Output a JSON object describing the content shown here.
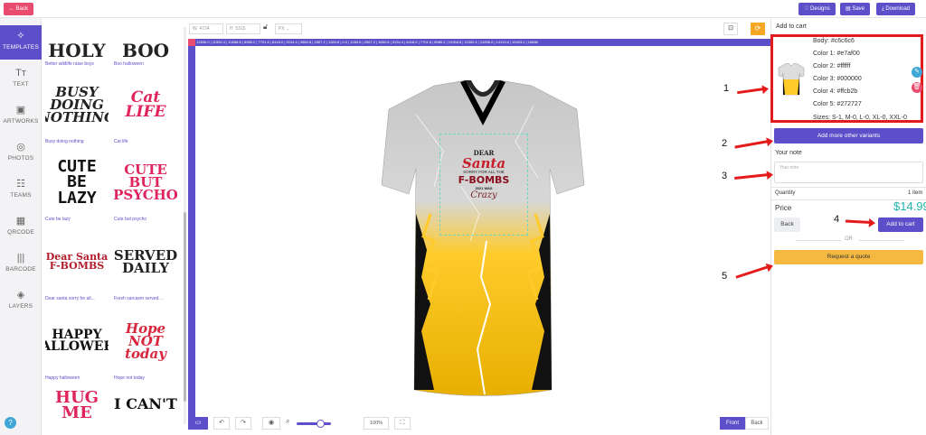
{
  "topbar": {
    "back": "Back",
    "designs": "♡ Designs",
    "save": "Save",
    "download": "Download"
  },
  "sidebar": [
    {
      "icon": "✧",
      "label": "TEMPLATES"
    },
    {
      "icon": "Tт",
      "label": "TEXT"
    },
    {
      "icon": "▣",
      "label": "ARTWORKS"
    },
    {
      "icon": "◎",
      "label": "PHOTOS"
    },
    {
      "icon": "☷",
      "label": "TEAMS"
    },
    {
      "icon": "▦",
      "label": "QRCODE"
    },
    {
      "icon": "|||",
      "label": "BARCODE"
    },
    {
      "icon": "◈",
      "label": "LAYERS"
    }
  ],
  "templates": [
    {
      "caption": "Better wildlife raise boys",
      "art": "HOLY"
    },
    {
      "caption": "Boo halloween",
      "art": "BOO"
    },
    {
      "caption": "Busy doing nothing",
      "art": "BUSY DOING NOTHING"
    },
    {
      "caption": "Cat life",
      "art": "Cat LIFE"
    },
    {
      "caption": "Cute be lazy",
      "art": "CUTE BE LAZY"
    },
    {
      "caption": "Cute but psycho",
      "art": "CUTE BUT PSYCHO"
    },
    {
      "caption": "Dear santa sorry for all...",
      "art": "Dear Santa F-BOMBS"
    },
    {
      "caption": "Fresh sarcasm served ...",
      "art": "SERVED DAILY"
    },
    {
      "caption": "Happy halloween",
      "art": "HAPPY HALLOWEEN"
    },
    {
      "caption": "Hope not today",
      "art": "Hope NOT today"
    },
    {
      "caption": "",
      "art": "HUG ME"
    },
    {
      "caption": "",
      "art": "I CAN'T"
    }
  ],
  "canvas": {
    "w_label": "W",
    "w_value": "4724",
    "h_label": "H",
    "h_value": "5315",
    "unit": "PX",
    "ruler_marks": "12836.0 | 11552.4 | 10268.8 | 8985.2 | 7701.6 | 6418.0 | 5134.4 | 3850.8 | 2567.2 | 1283.6 | 0.0 | 1283.6 | 2567.2 | 3850.8 | 5134.4 | 6418.0 | 7701.6 | 8985.2 | 10268.8 | 11552.4 | 12836.0 | 14119.6 | 15403.2 | 16686",
    "zoom": "100%",
    "front": "Front",
    "back": "Back",
    "design_text": {
      "dear": "DEAR",
      "santa": "Santa",
      "sorry": "SORRY FOR ALL THE",
      "fbombs": "F-BOMBS",
      "this_year": "2021 WAS",
      "crazy": "Crazy"
    }
  },
  "panel": {
    "title": "Add to cart",
    "variant": {
      "lines": [
        "Body: #c6c6c6",
        "Color 1: #e7af00",
        "Color 2: #ffffff",
        "Color 3: #000000",
        "Color 4: #ffcb2b",
        "Color 5: #272727",
        "Sizes: S-1, M-0, L-0, XL-0, XXL-0"
      ]
    },
    "add_variants": "Add more other variants",
    "note_label": "Your note",
    "note_placeholder": "Your note",
    "quantity_label": "Quantity",
    "quantity_value": "1 item",
    "price_label": "Price",
    "price_value": "$14.99",
    "back": "Back",
    "add_to_cart": "Add to cart",
    "or": "OR",
    "request_quote": "Request a quote"
  },
  "annotations": [
    "1",
    "2",
    "3",
    "4",
    "5"
  ],
  "colors": {
    "accent": "#5c4fc9",
    "danger": "#e94c6e",
    "price": "#20b2aa",
    "quote": "#f5b942",
    "annotation": "#e41b1b"
  }
}
